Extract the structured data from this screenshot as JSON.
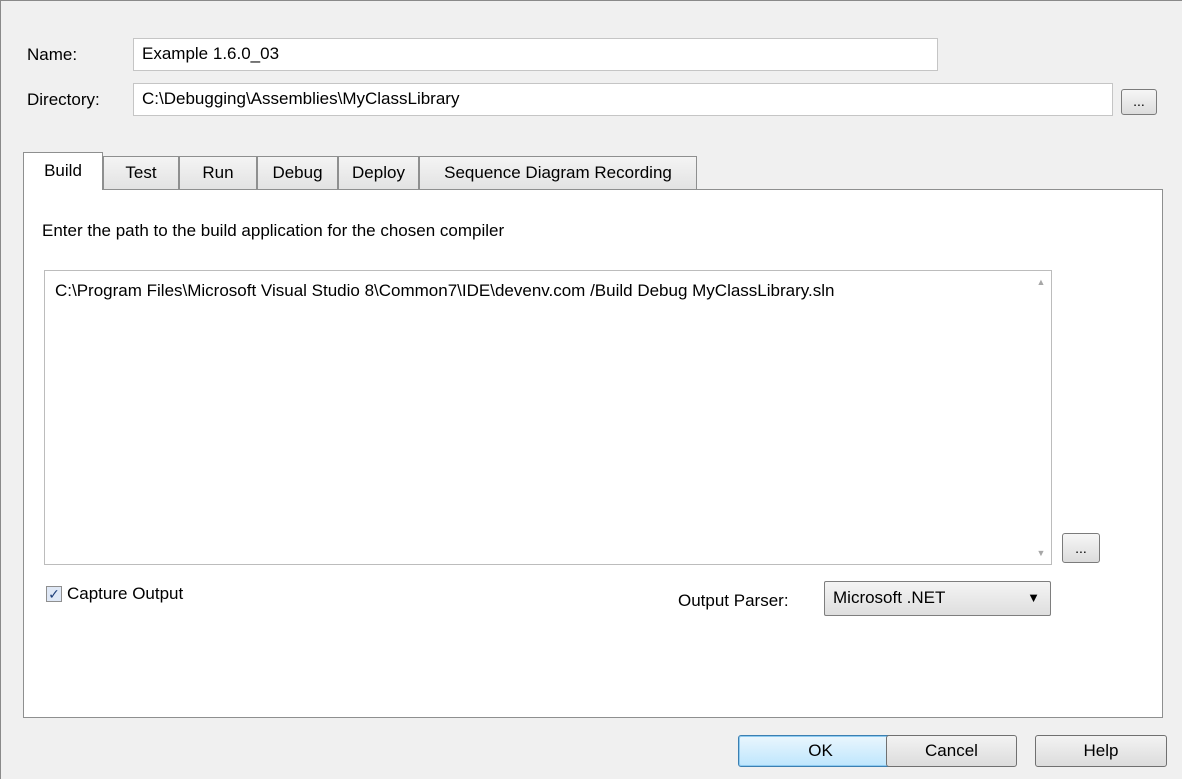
{
  "fields": {
    "name_label": "Name:",
    "name_value": "Example 1.6.0_03",
    "directory_label": "Directory:",
    "directory_value": "C:\\Debugging\\Assemblies\\MyClassLibrary",
    "browse_label": "..."
  },
  "tabs": [
    {
      "label": "Build",
      "active": true
    },
    {
      "label": "Test"
    },
    {
      "label": "Run"
    },
    {
      "label": "Debug"
    },
    {
      "label": "Deploy"
    },
    {
      "label": "Sequence Diagram Recording"
    }
  ],
  "build": {
    "instruction": "Enter the path to the build application for the chosen compiler",
    "command": "C:\\Program Files\\Microsoft Visual Studio 8\\Common7\\IDE\\devenv.com /Build Debug MyClassLibrary.sln",
    "browse_label": "...",
    "capture_output_label": "Capture Output",
    "capture_output_checked": true,
    "output_parser_label": "Output Parser:",
    "output_parser_value": "Microsoft .NET"
  },
  "buttons": {
    "ok": "OK",
    "cancel": "Cancel",
    "help": "Help"
  }
}
